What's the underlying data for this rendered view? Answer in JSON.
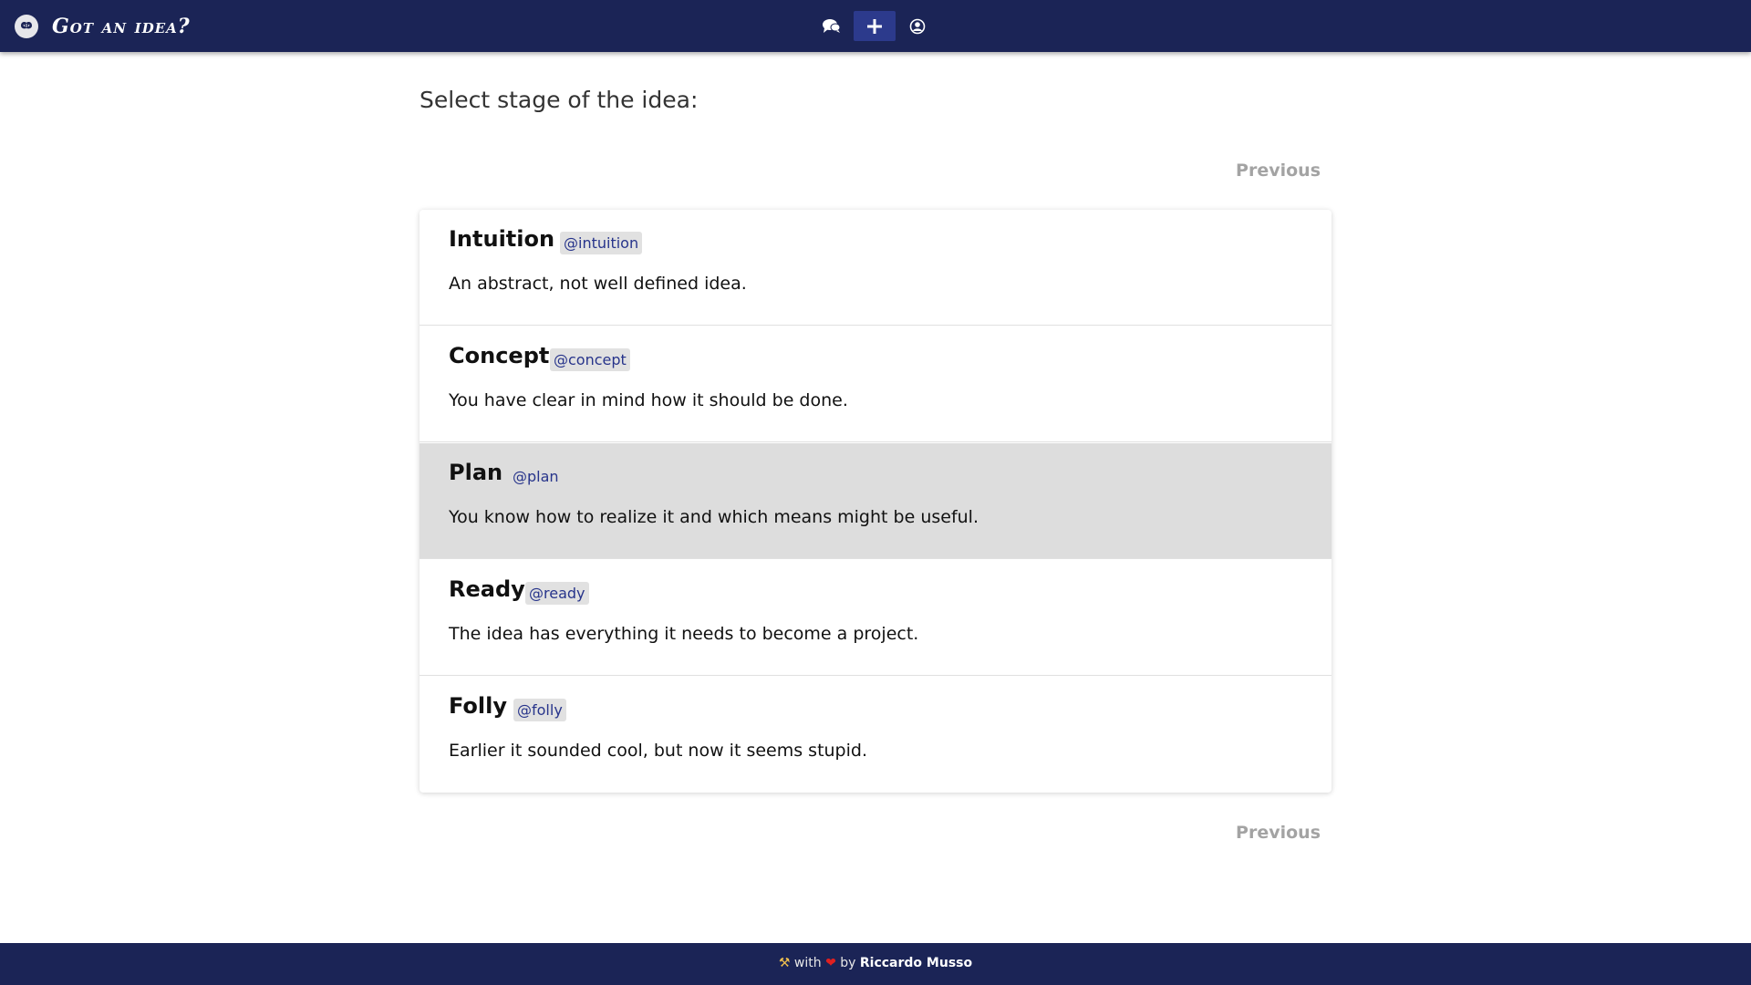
{
  "header": {
    "brand": "Got an idea?",
    "icons": [
      "brain-logo-icon",
      "chat-icon",
      "plus-icon",
      "user-icon"
    ]
  },
  "main": {
    "title": "Select stage of the idea:",
    "previous_top": "Previous",
    "previous_bottom": "Previous",
    "stages": [
      {
        "name": "Intuition",
        "tag": "@intuition",
        "desc": "An abstract, not well defined idea.",
        "selected": false
      },
      {
        "name": "Concept",
        "tag": "@concept",
        "desc": "You have clear in mind how it should be done.",
        "selected": false
      },
      {
        "name": "Plan",
        "tag": "@plan",
        "desc": "You know how to realize it and which means might be useful.",
        "selected": true
      },
      {
        "name": "Ready",
        "tag": "@ready",
        "desc": "The idea has everything it needs to become a project.",
        "selected": false
      },
      {
        "name": "Folly",
        "tag": "@folly",
        "desc": "Earlier it sounded cool, but now it seems stupid.",
        "selected": false
      }
    ]
  },
  "footer": {
    "tools_glyph": "⚒",
    "with": "with",
    "heart_glyph": "❤",
    "by": "by",
    "author": "Riccardo Musso"
  },
  "colors": {
    "navbar": "#1b2456",
    "active_button": "#2c3a8c",
    "tag_text": "#27348b",
    "selected_row": "#dddddd"
  }
}
